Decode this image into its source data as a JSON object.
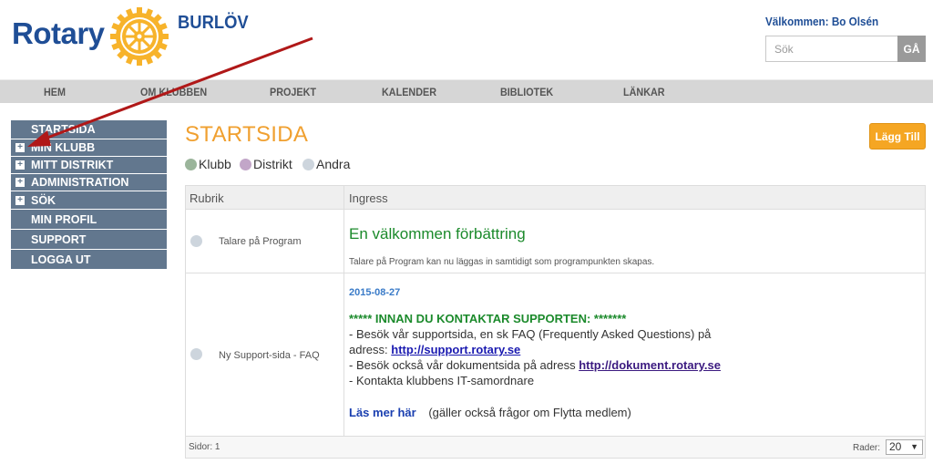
{
  "header": {
    "logo_text": "Rotary",
    "club_name": "BURLÖV",
    "welcome": "Välkommen: Bo Olsén",
    "search_placeholder": "Sök",
    "search_button": "GÅ"
  },
  "topnav": [
    "HEM",
    "OM KLUBBEN",
    "PROJEKT",
    "KALENDER",
    "BIBLIOTEK",
    "LÄNKAR"
  ],
  "sidebar": {
    "items": [
      {
        "label": "STARTSIDA",
        "expandable": false
      },
      {
        "label": "MIN KLUBB",
        "expandable": true
      },
      {
        "label": "MITT DISTRIKT",
        "expandable": true
      },
      {
        "label": "ADMINISTRATION",
        "expandable": true
      },
      {
        "label": "SÖK",
        "expandable": true
      },
      {
        "label": "MIN PROFIL",
        "expandable": false
      },
      {
        "label": "SUPPORT",
        "expandable": false
      },
      {
        "label": "LOGGA UT",
        "expandable": false
      }
    ],
    "plus_symbol": "+"
  },
  "main": {
    "title": "STARTSIDA",
    "add_button": "Lägg Till",
    "legend": [
      {
        "label": "Klubb",
        "color": "#9bb59b"
      },
      {
        "label": "Distrikt",
        "color": "#c2a6c8"
      },
      {
        "label": "Andra",
        "color": "#cdd5dd"
      }
    ],
    "table": {
      "headers": [
        "Rubrik",
        "Ingress"
      ],
      "rows": [
        {
          "rubrik": "Talare på Program",
          "title": "En välkommen förbättring",
          "text": "Talare på Program kan nu läggas in samtidigt som programpunkten skapas."
        },
        {
          "rubrik": "Ny Support-sida - FAQ",
          "date": "2015-08-27",
          "heading": "***** INNAN DU KONTAKTAR SUPPORTEN: *******",
          "line1": "- Besök vår supportsida, en sk FAQ (Frequently Asked Questions) på",
          "line2_prefix": "adress: ",
          "link1": "http://support.rotary.se",
          "line3_prefix": "- Besök också vår dokumentsida på adress ",
          "link2": "http://dokument.rotary.se",
          "line4": "- Kontakta klubbens IT-samordnare",
          "read_more": "Läs mer här",
          "read_more_note": "(gäller också frågor om Flytta medlem)"
        }
      ],
      "pages_text": "Sidor: 1",
      "rows_label": "Rader:",
      "rows_value": "20",
      "caret": "▼"
    }
  },
  "colors": {
    "brand_blue": "#1f4e96",
    "wheel_gold": "#f7b32b",
    "sidebar_bg": "#62778e",
    "title_orange": "#f0a030",
    "button_orange": "#f5a623",
    "news_green": "#1b8a2b",
    "arrow_red": "#b01818"
  }
}
